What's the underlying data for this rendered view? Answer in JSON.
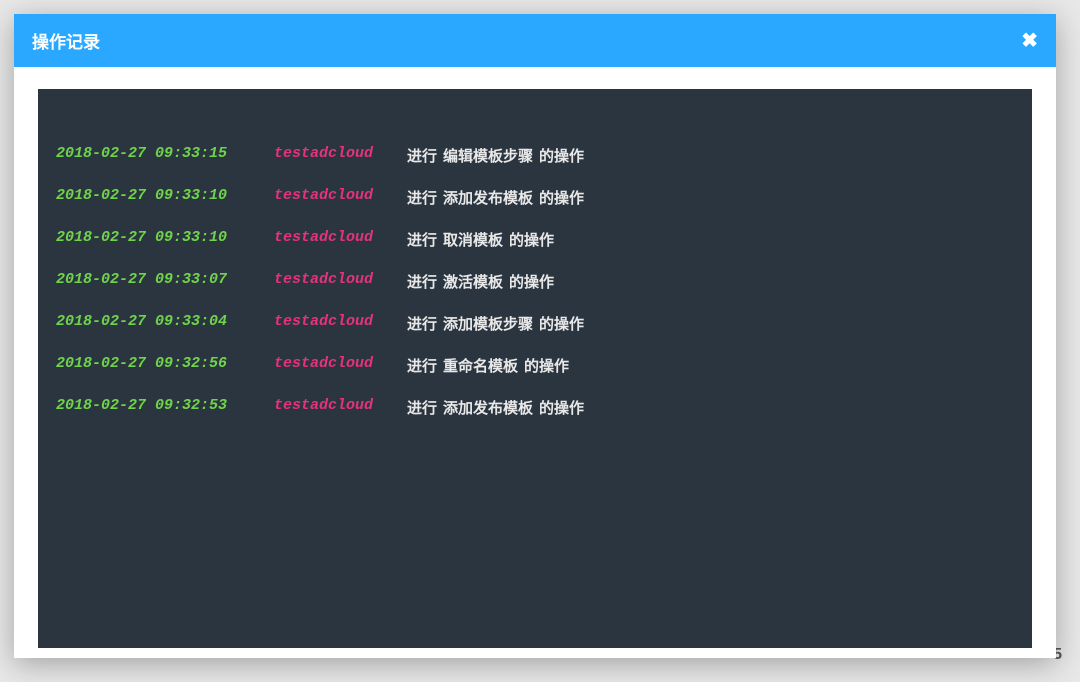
{
  "backdrop": {
    "number": "5"
  },
  "modal": {
    "title": "操作记录",
    "close_glyph": "✖"
  },
  "log": {
    "prefix": "进行",
    "suffix": "的操作",
    "entries": [
      {
        "ts": "2018-02-27 09:33:15",
        "user": "testadcloud",
        "op": "编辑模板步骤"
      },
      {
        "ts": "2018-02-27 09:33:10",
        "user": "testadcloud",
        "op": "添加发布模板"
      },
      {
        "ts": "2018-02-27 09:33:10",
        "user": "testadcloud",
        "op": "取消模板"
      },
      {
        "ts": "2018-02-27 09:33:07",
        "user": "testadcloud",
        "op": "激活模板"
      },
      {
        "ts": "2018-02-27 09:33:04",
        "user": "testadcloud",
        "op": "添加模板步骤"
      },
      {
        "ts": "2018-02-27 09:32:56",
        "user": "testadcloud",
        "op": "重命名模板"
      },
      {
        "ts": "2018-02-27 09:32:53",
        "user": "testadcloud",
        "op": "添加发布模板"
      }
    ]
  }
}
